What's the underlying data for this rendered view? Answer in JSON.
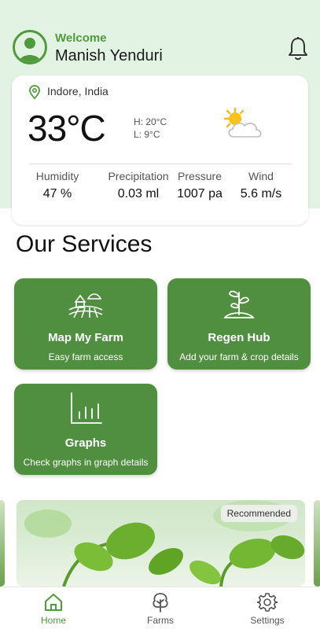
{
  "header": {
    "welcome": "Welcome",
    "user_name": "Manish Yenduri"
  },
  "weather": {
    "location": "Indore, India",
    "temperature": "33°C",
    "high": "H: 20°C",
    "low": "L: 9°C",
    "stats": [
      {
        "label": "Humidity",
        "value": "47 %"
      },
      {
        "label": "Precipitation",
        "value": "0.03 ml"
      },
      {
        "label": "Pressure",
        "value": "1007 pa"
      },
      {
        "label": "Wind",
        "value": "5.6 m/s"
      }
    ]
  },
  "services": {
    "title": "Our Services",
    "items": [
      {
        "title": "Map My Farm",
        "subtitle": "Easy farm access",
        "icon": "farm-map-icon"
      },
      {
        "title": "Regen Hub",
        "subtitle": "Add your farm & crop details",
        "icon": "sprout-icon"
      },
      {
        "title": "Graphs",
        "subtitle": "Check graphs in graph details",
        "icon": "bar-chart-icon"
      }
    ]
  },
  "promo": {
    "badge": "Recommended"
  },
  "nav": {
    "items": [
      {
        "label": "Home",
        "icon": "home-icon",
        "active": true
      },
      {
        "label": "Farms",
        "icon": "tree-icon",
        "active": false
      },
      {
        "label": "Settings",
        "icon": "gear-icon",
        "active": false
      }
    ]
  },
  "colors": {
    "accent": "#4f9a3c",
    "card_green": "#4f8f3f",
    "header_bg": "#e3f3e3"
  }
}
